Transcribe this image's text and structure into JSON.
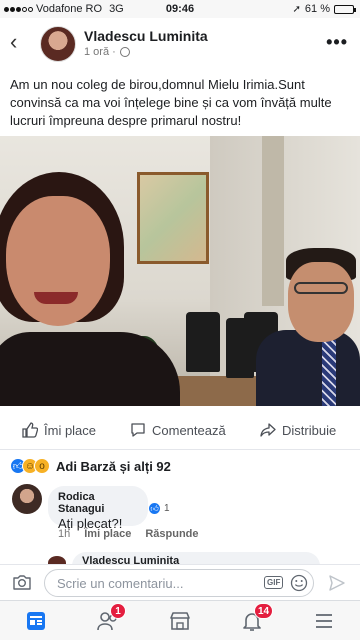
{
  "status_bar": {
    "carrier": "Vodafone RO",
    "network": "3G",
    "time": "09:46",
    "battery": "61 %",
    "battery_level": 0.61
  },
  "post": {
    "author": "Vladescu Luminita",
    "time_ago": "1 oră ·",
    "text": "Am un nou coleg de birou,domnul Mielu Irimia.Sunt convinsă ca ma voi înțelege bine și ca vom învăță multe lucruri împreuna despre primarul nostru!",
    "actions": {
      "like": "Îmi place",
      "comment": "Comentează",
      "share": "Distribuie"
    },
    "reactions": "Adi Barză și alți 92"
  },
  "comment": {
    "author": "Rodica Stanagui",
    "text": "Ați plecat?!",
    "like_count": "1",
    "time": "1h",
    "like_label": "Îmi place",
    "reply_label": "Răspunde"
  },
  "reply_preview": {
    "author": "Vladescu Luminita"
  },
  "composer": {
    "placeholder": "Scrie un comentariu...",
    "gif_label": "GIF"
  },
  "tabbar": {
    "friends_badge": "1",
    "notifications_badge": "14"
  },
  "colors": {
    "brand": "#1877f2",
    "badge": "#e41e3f"
  }
}
